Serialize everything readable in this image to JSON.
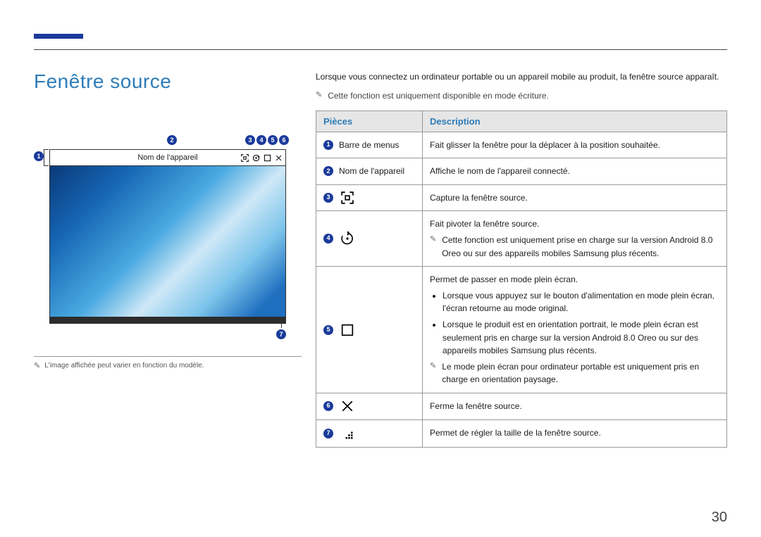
{
  "page_number": "30",
  "title": "Fenêtre source",
  "figure": {
    "device_name_label": "Nom de l'appareil",
    "markers": [
      "1",
      "2",
      "3",
      "4",
      "5",
      "6",
      "7"
    ]
  },
  "left_note": "L'image affichée peut varier en fonction du modèle.",
  "intro": "Lorsque vous connectez un ordinateur portable ou un appareil mobile au produit, la fenêtre source apparaît.",
  "intro_note": "Cette fonction est uniquement disponible en mode écriture.",
  "table": {
    "header_parts": "Pièces",
    "header_desc": "Description",
    "rows": [
      {
        "num": "1",
        "label": "Barre de menus",
        "icon": null,
        "desc": "Fait glisser la fenêtre pour la déplacer à la position souhaitée."
      },
      {
        "num": "2",
        "label": "Nom de l'appareil",
        "icon": null,
        "desc": "Affiche le nom de l'appareil connecté."
      },
      {
        "num": "3",
        "icon": "capture",
        "desc": "Capture la fenêtre source."
      },
      {
        "num": "4",
        "icon": "rotate",
        "desc": "Fait pivoter la fenêtre source.",
        "note": "Cette fonction est uniquement prise en charge sur la version Android 8.0 Oreo ou sur des appareils mobiles Samsung plus récents."
      },
      {
        "num": "5",
        "icon": "fullscreen",
        "desc": "Permet de passer en mode plein écran.",
        "bullets": [
          "Lorsque vous appuyez sur le bouton d'alimentation en mode plein écran, l'écran retourne au mode original.",
          "Lorsque le produit est en orientation portrait, le mode plein écran est seulement pris en charge sur la version Android 8.0 Oreo ou sur des appareils mobiles Samsung plus récents."
        ],
        "note": "Le mode plein écran pour ordinateur portable est uniquement pris en charge en orientation paysage."
      },
      {
        "num": "6",
        "icon": "close",
        "desc": "Ferme la fenêtre source."
      },
      {
        "num": "7",
        "icon": "resize",
        "desc": "Permet de régler la taille de la fenêtre source."
      }
    ]
  }
}
